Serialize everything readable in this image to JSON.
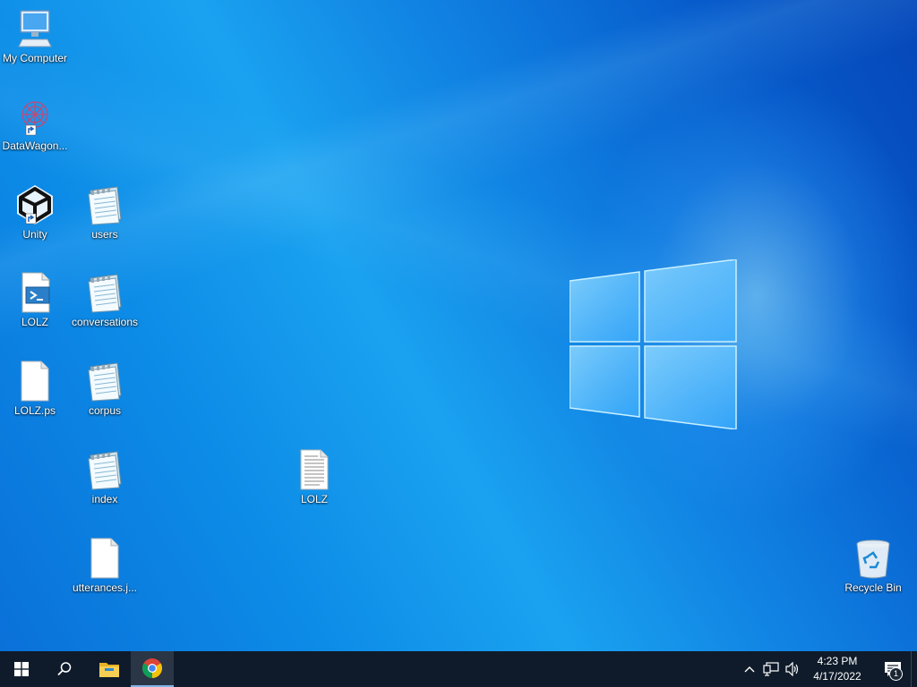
{
  "desktop": {
    "icons": [
      {
        "label": "My Computer",
        "icon": "computer-icon"
      },
      {
        "label": "DataWagon...",
        "icon": "datawagon-shortcut-icon"
      },
      {
        "label": "Unity",
        "icon": "unity-shortcut-icon"
      },
      {
        "label": "LOLZ",
        "icon": "powershell-script-icon"
      },
      {
        "label": "LOLZ.ps",
        "icon": "blank-file-icon"
      },
      {
        "label": "users",
        "icon": "notepad-file-icon"
      },
      {
        "label": "conversations",
        "icon": "notepad-file-icon"
      },
      {
        "label": "corpus",
        "icon": "notepad-file-icon"
      },
      {
        "label": "index",
        "icon": "notepad-file-icon"
      },
      {
        "label": "utterances.j...",
        "icon": "blank-file-icon"
      },
      {
        "label": "LOLZ",
        "icon": "text-document-icon"
      },
      {
        "label": "Recycle Bin",
        "icon": "recycle-bin-icon"
      }
    ]
  },
  "taskbar": {
    "start": "windows-start-icon",
    "search": "search-icon",
    "pinned": [
      "file-explorer-icon",
      "chrome-icon"
    ],
    "tray": {
      "icons": [
        "chevron-up-icon",
        "network-icon",
        "volume-icon"
      ],
      "time": "4:23 PM",
      "date": "4/17/2022",
      "notification_count": "1"
    }
  },
  "colors": {
    "taskbar_bg": "#0f1b2a",
    "desktop_accent": "#0c8ae6"
  }
}
